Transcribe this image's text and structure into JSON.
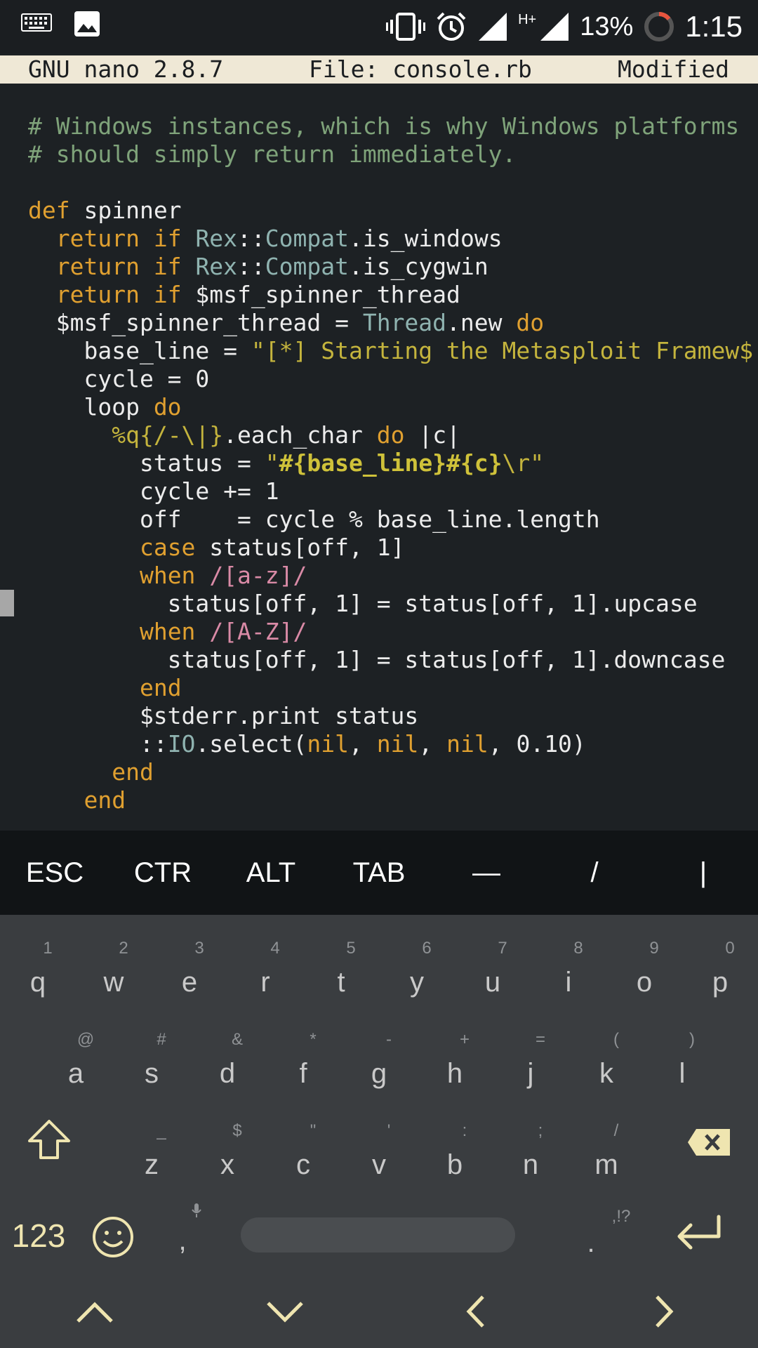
{
  "statusbar": {
    "battery": "13%",
    "time": "1:15",
    "network": "H+"
  },
  "nano": {
    "version": "GNU nano 2.8.7",
    "file": "File: console.rb",
    "state": "Modified"
  },
  "code_lines": [
    [
      {
        "t": "# Windows instances, which is why Windows platforms",
        "c": "comment"
      }
    ],
    [
      {
        "t": "# should simply return immediately.",
        "c": "comment"
      }
    ],
    [],
    [
      {
        "t": "def",
        "c": "kw"
      },
      {
        "t": " spinner",
        "c": "plain"
      }
    ],
    [
      {
        "t": "  "
      },
      {
        "t": "return if",
        "c": "kw"
      },
      {
        "t": " "
      },
      {
        "t": "Rex",
        "c": "const"
      },
      {
        "t": "::",
        "c": "plain"
      },
      {
        "t": "Compat",
        "c": "const"
      },
      {
        "t": ".is_windows",
        "c": "plain"
      }
    ],
    [
      {
        "t": "  "
      },
      {
        "t": "return if",
        "c": "kw"
      },
      {
        "t": " "
      },
      {
        "t": "Rex",
        "c": "const"
      },
      {
        "t": "::",
        "c": "plain"
      },
      {
        "t": "Compat",
        "c": "const"
      },
      {
        "t": ".is_cygwin",
        "c": "plain"
      }
    ],
    [
      {
        "t": "  "
      },
      {
        "t": "return if",
        "c": "kw"
      },
      {
        "t": " $msf_spinner_thread",
        "c": "plain"
      }
    ],
    [
      {
        "t": "  $msf_spinner_thread = ",
        "c": "plain"
      },
      {
        "t": "Thread",
        "c": "const"
      },
      {
        "t": ".new ",
        "c": "plain"
      },
      {
        "t": "do",
        "c": "kw"
      }
    ],
    [
      {
        "t": "    base_line = ",
        "c": "plain"
      },
      {
        "t": "\"[*] Starting the Metasploit Framew$",
        "c": "str"
      }
    ],
    [
      {
        "t": "    cycle = 0",
        "c": "plain"
      }
    ],
    [
      {
        "t": "    loop ",
        "c": "plain"
      },
      {
        "t": "do",
        "c": "kw"
      }
    ],
    [
      {
        "t": "      "
      },
      {
        "t": "%q{/-\\|}",
        "c": "str"
      },
      {
        "t": ".each_char ",
        "c": "plain"
      },
      {
        "t": "do",
        "c": "kw"
      },
      {
        "t": " |c|",
        "c": "plain"
      }
    ],
    [
      {
        "t": "        status = ",
        "c": "plain"
      },
      {
        "t": "\"",
        "c": "str"
      },
      {
        "t": "#{base_line}#{c}",
        "c": "interp"
      },
      {
        "t": "\\r\"",
        "c": "str"
      }
    ],
    [
      {
        "t": "        cycle += 1",
        "c": "plain"
      }
    ],
    [
      {
        "t": "        off    = cycle % base_line.length",
        "c": "plain"
      }
    ],
    [
      {
        "t": "        "
      },
      {
        "t": "case",
        "c": "kw"
      },
      {
        "t": " status[off, 1]",
        "c": "plain"
      }
    ],
    [
      {
        "t": "        "
      },
      {
        "t": "when",
        "c": "kw"
      },
      {
        "t": " "
      },
      {
        "t": "/[a-z]/",
        "c": "regex"
      }
    ],
    [
      {
        "t": "          status[off, 1] = status[off, 1].upcase",
        "c": "plain"
      }
    ],
    [
      {
        "t": "        "
      },
      {
        "t": "when",
        "c": "kw"
      },
      {
        "t": " "
      },
      {
        "t": "/[A-Z]/",
        "c": "regex"
      }
    ],
    [
      {
        "t": "          status[off, 1] = status[off, 1].downcase",
        "c": "plain"
      }
    ],
    [
      {
        "t": "        "
      },
      {
        "t": "end",
        "c": "kw"
      }
    ],
    [
      {
        "t": "        $stderr.print status",
        "c": "plain"
      }
    ],
    [
      {
        "t": "        ::",
        "c": "plain"
      },
      {
        "t": "IO",
        "c": "const"
      },
      {
        "t": ".select(",
        "c": "plain"
      },
      {
        "t": "nil",
        "c": "kw"
      },
      {
        "t": ", ",
        "c": "plain"
      },
      {
        "t": "nil",
        "c": "kw"
      },
      {
        "t": ", ",
        "c": "plain"
      },
      {
        "t": "nil",
        "c": "kw"
      },
      {
        "t": ", 0.10)",
        "c": "plain"
      }
    ],
    [
      {
        "t": "      "
      },
      {
        "t": "end",
        "c": "kw"
      }
    ],
    [
      {
        "t": "    "
      },
      {
        "t": "end",
        "c": "kw"
      }
    ]
  ],
  "extra_keys": [
    "ESC",
    "CTR",
    "ALT",
    "TAB",
    "—",
    "/",
    "|"
  ],
  "keyboard": {
    "row1": [
      {
        "k": "q",
        "h": "1"
      },
      {
        "k": "w",
        "h": "2"
      },
      {
        "k": "e",
        "h": "3"
      },
      {
        "k": "r",
        "h": "4"
      },
      {
        "k": "t",
        "h": "5"
      },
      {
        "k": "y",
        "h": "6"
      },
      {
        "k": "u",
        "h": "7"
      },
      {
        "k": "i",
        "h": "8"
      },
      {
        "k": "o",
        "h": "9"
      },
      {
        "k": "p",
        "h": "0"
      }
    ],
    "row2": [
      {
        "k": "a",
        "h": "@"
      },
      {
        "k": "s",
        "h": "#"
      },
      {
        "k": "d",
        "h": "&"
      },
      {
        "k": "f",
        "h": "*"
      },
      {
        "k": "g",
        "h": "-"
      },
      {
        "k": "h",
        "h": "+"
      },
      {
        "k": "j",
        "h": "="
      },
      {
        "k": "k",
        "h": "("
      },
      {
        "k": "l",
        "h": ")"
      }
    ],
    "row3": [
      {
        "k": "z",
        "h": "_"
      },
      {
        "k": "x",
        "h": "$"
      },
      {
        "k": "c",
        "h": "\""
      },
      {
        "k": "v",
        "h": "'"
      },
      {
        "k": "b",
        "h": ":"
      },
      {
        "k": "n",
        "h": ";"
      },
      {
        "k": "m",
        "h": "/"
      }
    ],
    "num_label": "123",
    "comma": ",",
    "period": ".",
    "period_hint": ",!?"
  },
  "colors": {
    "comment": "#7fa37a",
    "kw": "#e0a030",
    "const": "#8fb3b0",
    "str": "#c4b43d",
    "interp": "#cfc23a",
    "regex": "#d98aa6",
    "plain": "#ececec",
    "accent_key": "#efe5b0"
  }
}
